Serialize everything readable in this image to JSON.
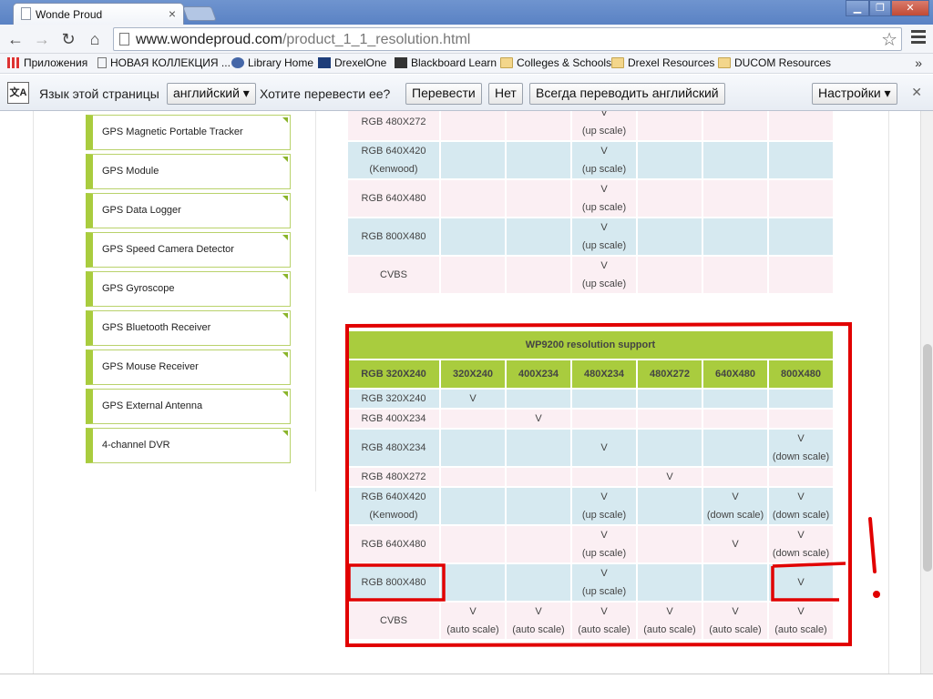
{
  "tab": {
    "title": "Wonde Proud",
    "close": "×"
  },
  "window": {
    "minimize": "▁",
    "maximize": "❐",
    "close": "✕"
  },
  "toolbar": {
    "back": "←",
    "forward": "→",
    "reload": "↻",
    "home": "⌂",
    "url_host": "www.wondeproud.com",
    "url_path": "/product_1_1_resolution.html",
    "star": "☆"
  },
  "bookmarks": [
    {
      "label": "Приложения",
      "icon": "apps-grid-icon"
    },
    {
      "label": "НОВАЯ КОЛЛЕКЦИЯ ...",
      "icon": "page-icon"
    },
    {
      "label": "Library Home",
      "icon": "library-icon"
    },
    {
      "label": "DrexelOne",
      "icon": "drexel-icon"
    },
    {
      "label": "Blackboard Learn",
      "icon": "blackboard-icon"
    },
    {
      "label": "Colleges & Schools",
      "icon": "folder-icon"
    },
    {
      "label": "Drexel Resources",
      "icon": "folder-icon"
    },
    {
      "label": "DUCOM Resources",
      "icon": "folder-icon"
    }
  ],
  "bookmarks_more": "»",
  "translate": {
    "prompt": "Язык этой страницы",
    "language": "английский",
    "question": "Хотите перевести ее?",
    "translate_btn": "Перевести",
    "no_btn": "Нет",
    "always_btn": "Всегда переводить английский",
    "settings_btn": "Настройки",
    "close": "✕"
  },
  "sidebar": [
    "GPS Magnetic Portable Tracker",
    "GPS Module",
    "GPS Data Logger",
    "GPS Speed Camera Detector",
    "GPS Gyroscope",
    "GPS Bluetooth Receiver",
    "GPS Mouse Receiver",
    "GPS External Antenna",
    "4-channel DVR"
  ],
  "table_top": {
    "rows": [
      {
        "label": [
          "RGB 480X272"
        ],
        "cells": [
          [],
          [],
          [
            "V",
            "(up scale)"
          ],
          [],
          [],
          []
        ]
      },
      {
        "label": [
          "RGB 640X420",
          "(Kenwood)"
        ],
        "cells": [
          [],
          [],
          [
            "V",
            "(up scale)"
          ],
          [],
          [],
          []
        ]
      },
      {
        "label": [
          "RGB 640X480"
        ],
        "cells": [
          [],
          [],
          [
            "V",
            "(up scale)"
          ],
          [],
          [],
          []
        ]
      },
      {
        "label": [
          "RGB 800X480"
        ],
        "cells": [
          [],
          [],
          [
            "V",
            "(up scale)"
          ],
          [],
          [],
          []
        ]
      },
      {
        "label": [
          "CVBS"
        ],
        "cells": [
          [],
          [],
          [
            "V",
            "(up scale)"
          ],
          [],
          [],
          []
        ]
      }
    ]
  },
  "table_main": {
    "title": "WP9200 resolution support",
    "headers": [
      "RGB 320X240",
      "320X240",
      "400X234",
      "480X234",
      "480X272",
      "640X480",
      "800X480"
    ],
    "rows": [
      {
        "label": [
          "RGB 320X240"
        ],
        "cells": [
          [
            "V"
          ],
          [],
          [],
          [],
          [],
          []
        ]
      },
      {
        "label": [
          "RGB 400X234"
        ],
        "cells": [
          [],
          [
            "V"
          ],
          [],
          [],
          [],
          []
        ]
      },
      {
        "label": [
          "RGB 480X234"
        ],
        "cells": [
          [],
          [],
          [
            "V"
          ],
          [],
          [],
          [
            "V",
            "(down scale)"
          ]
        ]
      },
      {
        "label": [
          "RGB 480X272"
        ],
        "cells": [
          [],
          [],
          [],
          [
            "V"
          ],
          [],
          []
        ]
      },
      {
        "label": [
          "RGB 640X420",
          "(Kenwood)"
        ],
        "cells": [
          [],
          [],
          [
            "V",
            "(up scale)"
          ],
          [],
          [
            "V",
            "(down scale)"
          ],
          [
            "V",
            "(down scale)"
          ]
        ]
      },
      {
        "label": [
          "RGB 640X480"
        ],
        "cells": [
          [],
          [],
          [
            "V",
            "(up scale)"
          ],
          [],
          [
            "V"
          ],
          [
            "V",
            "(down scale)"
          ]
        ]
      },
      {
        "label": [
          "RGB 800X480"
        ],
        "cells": [
          [],
          [],
          [
            "V",
            "(up scale)"
          ],
          [],
          [],
          [
            "V"
          ]
        ]
      },
      {
        "label": [
          "CVBS"
        ],
        "cells": [
          [
            "V",
            "(auto scale)"
          ],
          [
            "V",
            "(auto scale)"
          ],
          [
            "V",
            "(auto scale)"
          ],
          [
            "V",
            "(auto scale)"
          ],
          [
            "V",
            "(auto scale)"
          ],
          [
            "V",
            "(auto scale)"
          ]
        ]
      }
    ]
  },
  "colors": {
    "accent_green": "#a9cc3e",
    "row_pink": "#fbeff3",
    "row_blue": "#d6e9f0",
    "annotation_red": "#e10000"
  }
}
